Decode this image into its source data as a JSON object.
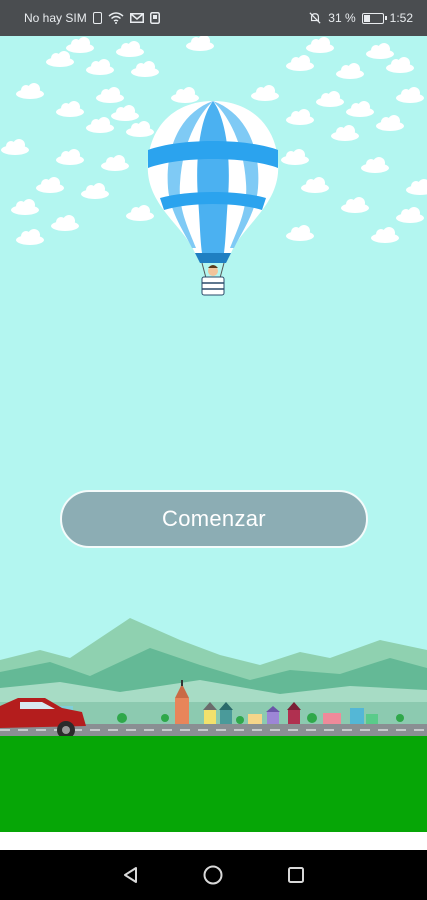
{
  "status_bar": {
    "carrier": "No hay SIM",
    "battery_percent": "31 %",
    "battery_level": 0.31,
    "time": "1:52",
    "icons": [
      "sim-icon",
      "wifi-icon",
      "mail-icon",
      "screenshot-icon",
      "mute-icon",
      "battery-icon"
    ]
  },
  "main": {
    "start_label": "Comenzar"
  },
  "nav_bar": {
    "icons": [
      "back-icon",
      "home-icon",
      "recents-icon"
    ]
  },
  "colors": {
    "sky": "#b3f6f0",
    "button": "#8cadb4",
    "grass": "#06a606",
    "balloon_blue": "#2ba3ee",
    "car": "#b41d1d"
  }
}
